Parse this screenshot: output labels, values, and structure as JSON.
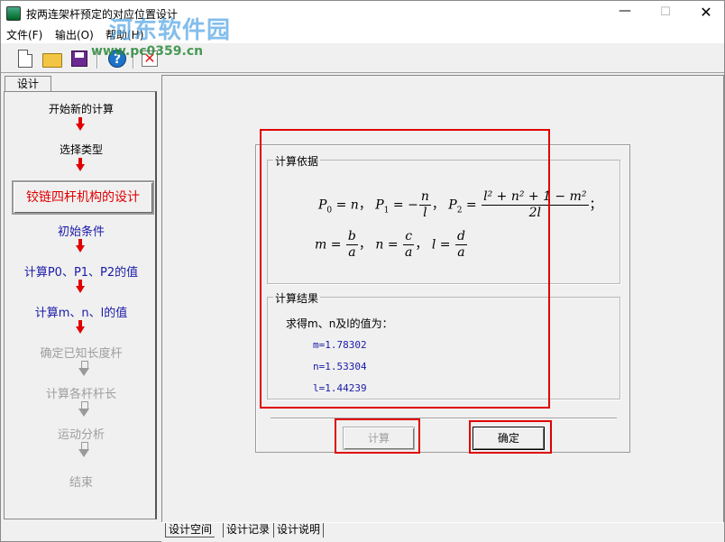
{
  "window": {
    "title": "按两连架杆预定的对应位置设计",
    "minimize_label": "—",
    "maximize_label": "☐",
    "close_label": "✕"
  },
  "watermark": {
    "text": "河东软件园",
    "url": "www.pc0359.cn"
  },
  "menu": {
    "items": [
      {
        "label": "文件(F)"
      },
      {
        "label": "输出(O)"
      },
      {
        "label": "帮助(H)"
      }
    ]
  },
  "toolbar": {
    "buttons": [
      {
        "name": "new-icon"
      },
      {
        "name": "open-icon"
      },
      {
        "name": "save-icon"
      },
      {
        "name": "help-icon",
        "glyph": "?"
      },
      {
        "name": "exit-icon",
        "glyph": "✕"
      }
    ]
  },
  "left_panel": {
    "tab_label": "设计",
    "steps": [
      {
        "label": "开始新的计算",
        "state": "done"
      },
      {
        "label": "选择类型",
        "state": "done"
      },
      {
        "label": "铰链四杆机构的设计",
        "state": "current"
      },
      {
        "label": "初始条件",
        "state": "active"
      },
      {
        "label": "计算P0、P1、P2的值",
        "state": "active"
      },
      {
        "label": "计算m、n、l的值",
        "state": "active"
      },
      {
        "label": "确定已知长度杆",
        "state": "disabled"
      },
      {
        "label": "计算各杆杆长",
        "state": "disabled"
      },
      {
        "label": "运动分析",
        "state": "disabled"
      },
      {
        "label": "结束",
        "state": "disabled"
      }
    ]
  },
  "dialog": {
    "basis_title": "计算依据",
    "formula": {
      "p0_lhs": "P",
      "p0_sub": "0",
      "p0_rhs": "n",
      "p1_lhs": "P",
      "p1_sub": "1",
      "p1_sign": "−",
      "p1_num": "n",
      "p1_den": "l",
      "p2_lhs": "P",
      "p2_sub": "2",
      "p2_num": "l² + n² + 1 − m²",
      "p2_den": "2l",
      "m_lhs": "m",
      "m_num": "b",
      "m_den": "a",
      "n_lhs": "n",
      "n_num": "c",
      "n_den": "a",
      "l_lhs": "l",
      "l_num": "d",
      "l_den": "a",
      "sep": "，",
      "end": "；"
    },
    "result_title": "计算结果",
    "result_label": "求得m、n及l的值为：",
    "results": [
      {
        "text": "m=1.78302"
      },
      {
        "text": "n=1.53304"
      },
      {
        "text": "l=1.44239"
      }
    ],
    "calculate_label": "计算",
    "ok_label": "确定"
  },
  "bottom_tabs": [
    {
      "label": "设计空间"
    },
    {
      "label": "设计记录"
    },
    {
      "label": "设计说明"
    }
  ],
  "colors": {
    "highlight_red": "#e00000",
    "active_step_blue": "#1a1aa8",
    "disabled_grey": "#9e9e9e"
  }
}
